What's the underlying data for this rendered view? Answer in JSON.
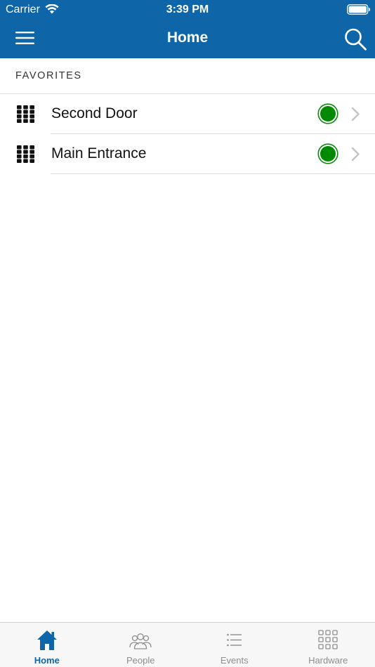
{
  "status_bar": {
    "carrier": "Carrier",
    "time": "3:39 PM",
    "wifi_icon": "wifi-icon",
    "battery_icon": "battery-full-icon"
  },
  "header": {
    "title": "Home",
    "menu_icon": "hamburger-menu-icon",
    "search_icon": "search-icon",
    "background_color": "#0e66a8"
  },
  "favorites": {
    "section_title": "FAVORITES",
    "items": [
      {
        "label": "Second Door",
        "icon": "keypad-icon",
        "status_color": "#008a00",
        "chevron": "chevron-right-icon"
      },
      {
        "label": "Main Entrance",
        "icon": "keypad-icon",
        "status_color": "#008a00",
        "chevron": "chevron-right-icon"
      }
    ]
  },
  "tab_bar": {
    "active_color": "#0e66a8",
    "inactive_color": "#8e8e8e",
    "tabs": [
      {
        "label": "Home",
        "icon": "home-icon",
        "active": true
      },
      {
        "label": "People",
        "icon": "people-icon",
        "active": false
      },
      {
        "label": "Events",
        "icon": "list-icon",
        "active": false
      },
      {
        "label": "Hardware",
        "icon": "grid-icon",
        "active": false
      }
    ]
  }
}
